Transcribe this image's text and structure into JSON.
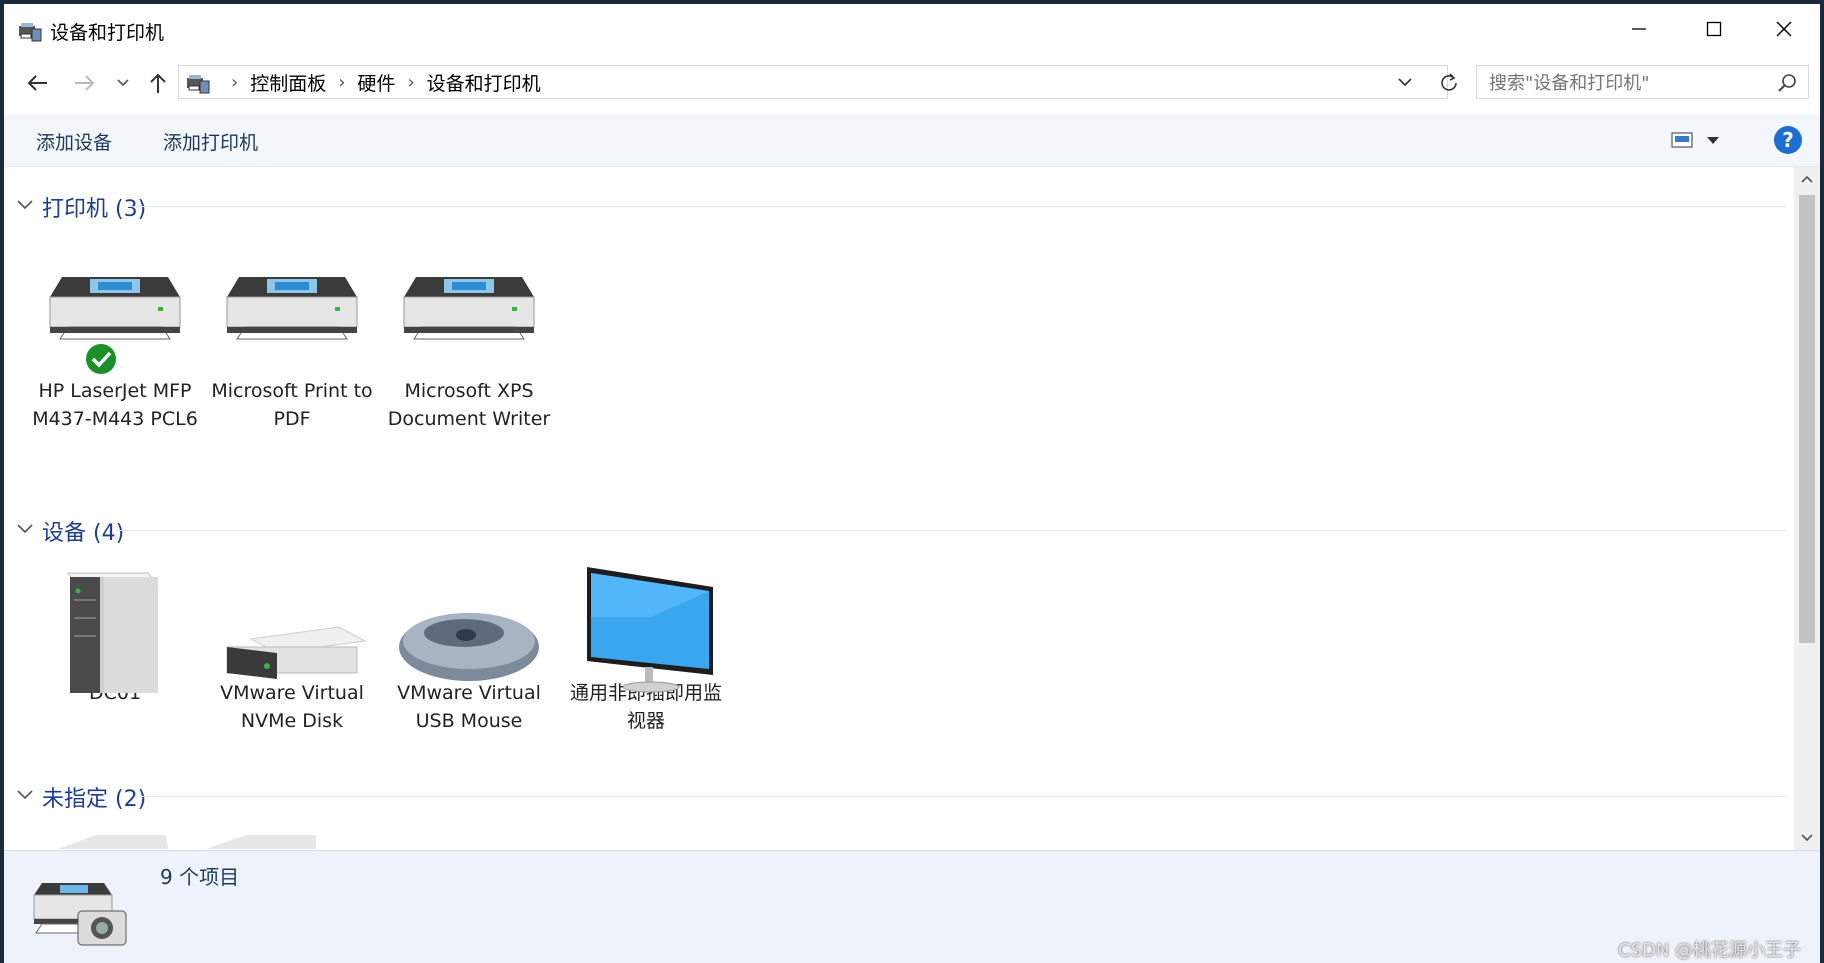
{
  "window": {
    "title": "设备和打印机"
  },
  "nav": {
    "breadcrumbs": [
      "控制面板",
      "硬件",
      "设备和打印机"
    ],
    "search_placeholder": "搜索\"设备和打印机\""
  },
  "toolbar": {
    "add_device": "添加设备",
    "add_printer": "添加打印机",
    "help_label": "?"
  },
  "groups": {
    "printers": {
      "title": "打印机 (3)",
      "items": [
        {
          "name": "HP LaserJet MFP M437-M443 PCL6",
          "default": true
        },
        {
          "name": "Microsoft Print to PDF"
        },
        {
          "name": "Microsoft XPS Document Writer"
        }
      ]
    },
    "devices": {
      "title": "设备 (4)",
      "items": [
        {
          "name": "DC01"
        },
        {
          "name": "VMware Virtual NVMe Disk"
        },
        {
          "name": "VMware Virtual USB Mouse"
        },
        {
          "name": "通用非即插即用监视器"
        }
      ]
    },
    "unspecified": {
      "title": "未指定 (2)"
    }
  },
  "details": {
    "item_count": "9 个项目"
  },
  "watermark": "CSDN @桃花源小王子",
  "colors": {
    "accent": "#1e3d8f",
    "command_bar": "#f3f6fb",
    "details_pane": "#eef2fa",
    "default_check": "#1a8f2a"
  }
}
